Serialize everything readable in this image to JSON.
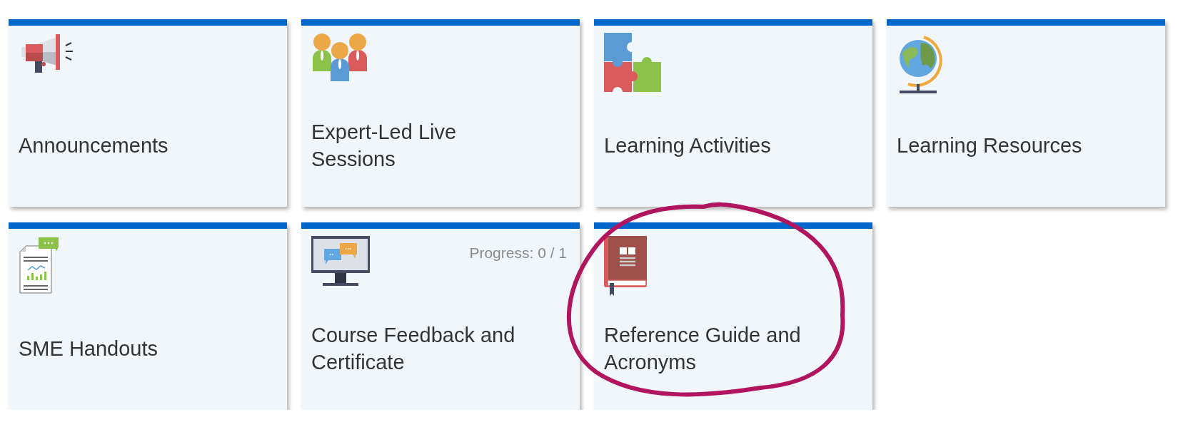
{
  "tiles": [
    {
      "title": "Announcements",
      "circled": false
    },
    {
      "title": "Expert-Led Live Sessions",
      "circled": false
    },
    {
      "title": "Learning Activities",
      "circled": false
    },
    {
      "title": "Learning Resources",
      "circled": false
    },
    {
      "title": "SME Handouts",
      "circled": false
    },
    {
      "title": "Course Feedback and Certificate",
      "progress": "Progress: 0 / 1",
      "circled": false
    },
    {
      "title": "Reference Guide and Acronyms",
      "circled": true
    }
  ]
}
